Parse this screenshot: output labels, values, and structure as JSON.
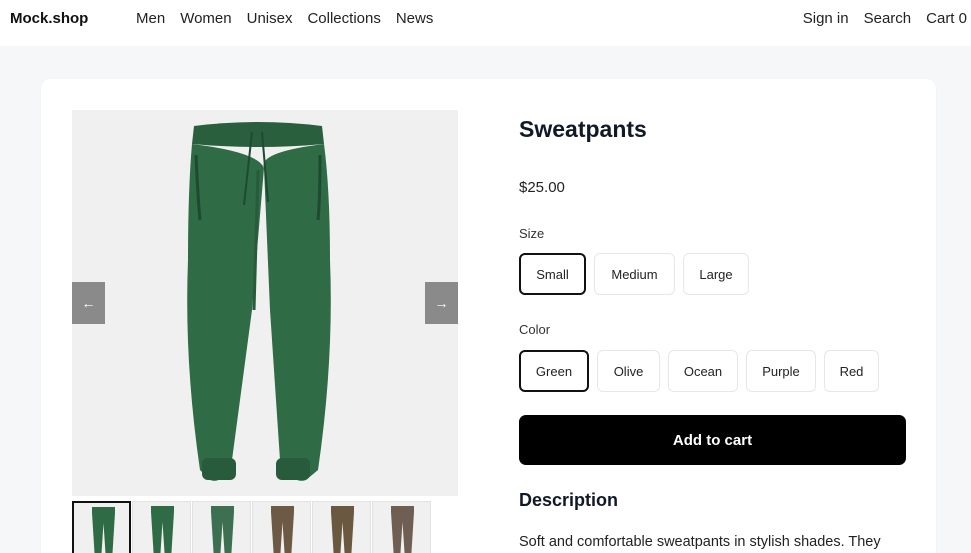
{
  "header": {
    "brand": "Mock.shop",
    "nav": [
      "Men",
      "Women",
      "Unisex",
      "Collections",
      "News"
    ],
    "sign_in": "Sign in",
    "search": "Search",
    "cart": "Cart 0"
  },
  "gallery": {
    "prev_label": "←",
    "next_label": "→",
    "thumbnail_colors": [
      "#2f6b45",
      "#2f6b45",
      "#3d7050",
      "#6d5a45",
      "#6a5840",
      "#6f5f52"
    ],
    "active_index": 0
  },
  "product": {
    "title": "Sweatpants",
    "price": "$25.00",
    "size_label": "Size",
    "sizes": [
      "Small",
      "Medium",
      "Large"
    ],
    "selected_size": "Small",
    "color_label": "Color",
    "colors": [
      "Green",
      "Olive",
      "Ocean",
      "Purple",
      "Red"
    ],
    "selected_color": "Green",
    "add_to_cart": "Add to cart",
    "description_heading": "Description",
    "description": "Soft and comfortable sweatpants in stylish shades. They"
  },
  "colors": {
    "accent": "#000000",
    "pants_green": "#2f6b45",
    "page_bg": "#f6f7f9"
  }
}
